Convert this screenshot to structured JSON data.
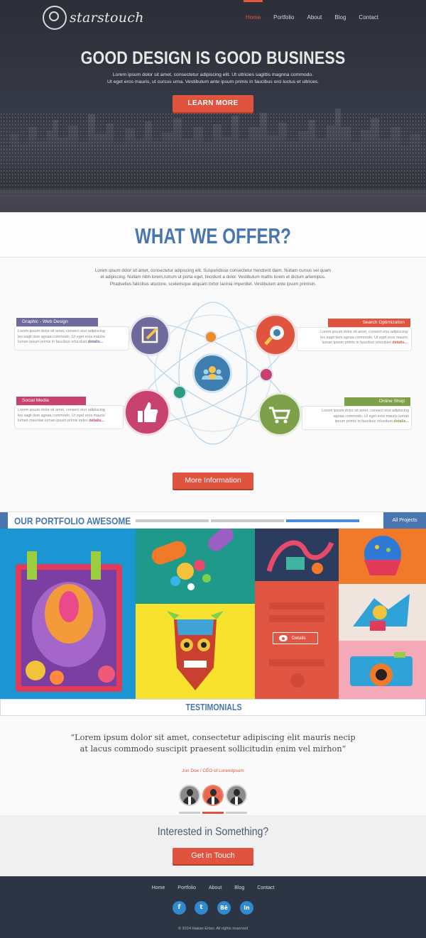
{
  "brand": {
    "name": "starstouch"
  },
  "nav": {
    "items": [
      "Home",
      "Portfolio",
      "About",
      "Blog",
      "Contact"
    ],
    "active": "Home"
  },
  "hero": {
    "title": "GOOD DESIGN IS GOOD BUSINESS",
    "subtitle_line1": "Lorem ipsum dolor sit amet, consectetur adipiscing elit. Ut ultricies sagittis magnna commodo.",
    "subtitle_line2": "Ut eget eros mauris, ut cursus urna. Vestibulum ante ipsum primis in faucibus orci luctus et ultrices.",
    "button": "LEARN MORE"
  },
  "offer": {
    "title": "WHAT WE OFFER?",
    "intro_line1": "Lorem ipsum dolor sit amet, consectetur adipiscing elit. Suspendisse consectetur hendrerit diam. Nullam cursus vel quam",
    "intro_line2": "et adipiscing. Nullam nibh lorem,rutrum ut porta eget, tincidunt a dolor. Vestibulum mattis lorem et dictum artemipus.",
    "intro_line3": "Phadsellus faticilisis atuctore, scelerisque aliquam tortor lacinia imperdiet. Vestibulum ante ipsum primisin.",
    "features": [
      {
        "label": "Graphic - Web Design",
        "line1": "Lorem ipsum dolor sit amet, consect etur adipiscing",
        "line2": "les sagit tism agnaa commodo. Ut eget eros mauris",
        "line3": "luman ipsum primis in faucibus orlucduet",
        "more": "detalis...",
        "color": "#6f6a9c",
        "icon": "pencil-icon"
      },
      {
        "label": "Search Optimization",
        "line1": "Lorem ipsum dolor sit amet, consect etur adipiscing",
        "line2": "les sagit tism agnaa commodo. Ut eget eros mauris",
        "line3": "luman ipsum primis in faucibus orlucduet",
        "more": "detalis...",
        "color": "#e0533f",
        "icon": "magnifier-icon"
      },
      {
        "label": "Social Media",
        "line1": "Lorem ipsum dolor sit amet, consect etur adipiscing",
        "line2": "les sagit tism agnaa commodo. Ut eget eros mauris",
        "line3": "luman mauriise iuman ipsum primis index",
        "more": "detalis...",
        "color": "#c9416f",
        "icon": "thumbs-up-icon"
      },
      {
        "label": "Online Shop",
        "line1": "Lorem ipsum dolor sit amet, consect etur adipiscing",
        "line2": "agnaa commodo. Ut eget eros mauris luman",
        "line3": "ipsum primis in faucibus orlucduet",
        "more": "detalis...",
        "color": "#7fa04a",
        "icon": "cart-icon"
      }
    ],
    "button": "More Information"
  },
  "portfolio": {
    "title": "OUR PORTFOLIO AWESOME",
    "all_button": "All Projects",
    "details": "Details"
  },
  "testimonials": {
    "title": "TESTIMONIALS",
    "quote_line1": "“Lorem ipsum dolor sit amet, consectetur adipiscing elit mauris necip",
    "quote_line2": "at lacus commodo suscipit praesent sollicitudin enim vel mirhon”",
    "author": "Jon Doe / CEO of LoremIpsum"
  },
  "cta": {
    "title": "Interested in Something?",
    "button": "Get in Touch"
  },
  "footer": {
    "nav": [
      "Home",
      "Portfolio",
      "About",
      "Blog",
      "Contact"
    ],
    "social": [
      {
        "name": "facebook-icon",
        "glyph": "f"
      },
      {
        "name": "twitter-icon",
        "glyph": "t"
      },
      {
        "name": "behance-icon",
        "glyph": "Bē"
      },
      {
        "name": "linkedin-icon",
        "glyph": "in"
      }
    ],
    "copyright": "© 2014 Hakan Ertan. All rights reserved"
  },
  "colors": {
    "accent": "#e0533f",
    "brand_blue": "#4976ae",
    "footer_bg": "#2c3544"
  }
}
